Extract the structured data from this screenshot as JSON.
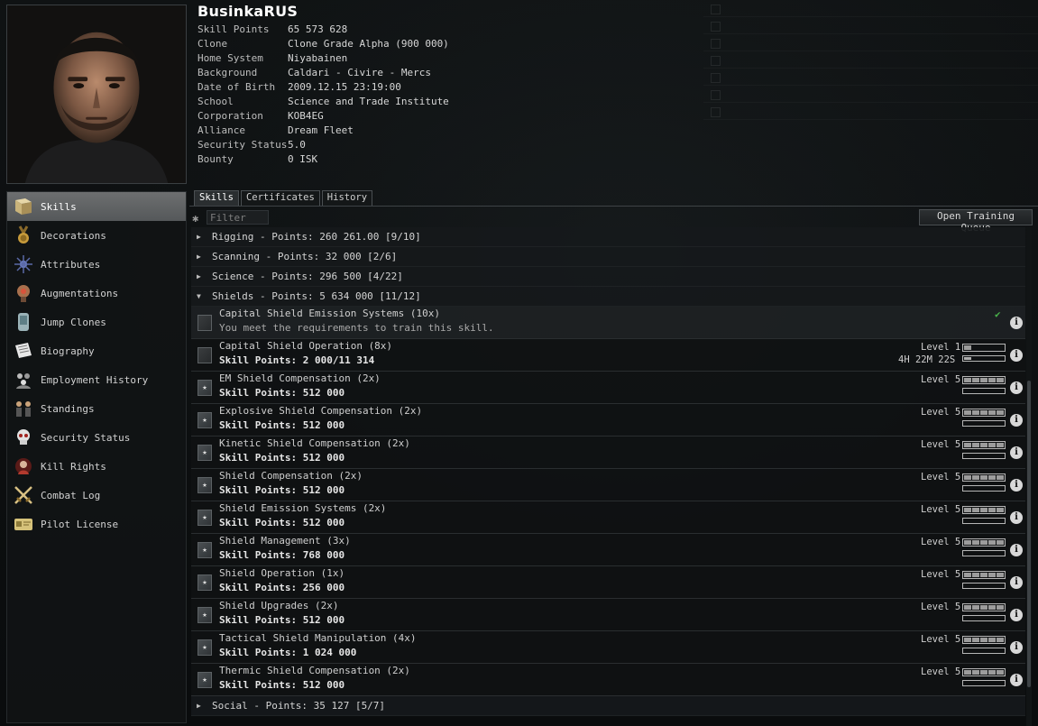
{
  "character": {
    "name": "BusinkaRUS",
    "info": [
      {
        "label": "Skill Points",
        "value": "65 573 628"
      },
      {
        "label": "Clone",
        "value": "Clone Grade Alpha (900 000)"
      },
      {
        "label": "Home System",
        "value": "Niyabainen"
      },
      {
        "label": "Background",
        "value": "Caldari - Civire - Mercs"
      },
      {
        "label": "Date of Birth",
        "value": "2009.12.15 23:19:00"
      },
      {
        "label": "School",
        "value": "Science and Trade Institute"
      },
      {
        "label": "Corporation",
        "value": "KOB4EG"
      },
      {
        "label": "Alliance",
        "value": "Dream Fleet"
      },
      {
        "label": "Security Status",
        "value": "5.0"
      },
      {
        "label": "Bounty",
        "value": "0 ISK"
      }
    ]
  },
  "nav": {
    "items": [
      {
        "label": "Skills",
        "icon": "skills-book-icon",
        "active": true
      },
      {
        "label": "Decorations",
        "icon": "medal-icon",
        "active": false
      },
      {
        "label": "Attributes",
        "icon": "attributes-icon",
        "active": false
      },
      {
        "label": "Augmentations",
        "icon": "implant-icon",
        "active": false
      },
      {
        "label": "Jump Clones",
        "icon": "jump-clone-icon",
        "active": false
      },
      {
        "label": "Biography",
        "icon": "biography-icon",
        "active": false
      },
      {
        "label": "Employment History",
        "icon": "employment-icon",
        "active": false
      },
      {
        "label": "Standings",
        "icon": "standings-icon",
        "active": false
      },
      {
        "label": "Security Status",
        "icon": "skull-icon",
        "active": false
      },
      {
        "label": "Kill Rights",
        "icon": "kill-rights-icon",
        "active": false
      },
      {
        "label": "Combat Log",
        "icon": "crossed-swords-icon",
        "active": false
      },
      {
        "label": "Pilot License",
        "icon": "license-card-icon",
        "active": false
      }
    ]
  },
  "tabs": {
    "skills": "Skills",
    "certificates": "Certificates",
    "history": "History"
  },
  "toolbar": {
    "filter_placeholder": "Filter",
    "open_queue_label": "Open Training Queue"
  },
  "groups_top": [
    {
      "label": "Rigging - Points: 260 261.00 [9/10]",
      "expanded": false
    },
    {
      "label": "Scanning - Points: 32 000 [2/6]",
      "expanded": false
    },
    {
      "label": "Science - Points: 296 500 [4/22]",
      "expanded": false
    },
    {
      "label": "Shields - Points: 5 634 000 [11/12]",
      "expanded": true
    }
  ],
  "shield_skills": [
    {
      "name": "Capital Shield Emission Systems (10x)",
      "note": "You meet the requirements to train this skill.",
      "untrained": true,
      "can_train": true
    },
    {
      "name": "Capital Shield Operation (8x)",
      "points": "Skill Points: 2 000/11 314",
      "level": "Level 1",
      "level_num": 1,
      "timer": "4H 22M 22S",
      "progress": 0.18,
      "untrained": true
    },
    {
      "name": "EM Shield Compensation (2x)",
      "points": "Skill Points: 512 000",
      "level": "Level 5",
      "level_num": 5
    },
    {
      "name": "Explosive Shield Compensation (2x)",
      "points": "Skill Points: 512 000",
      "level": "Level 5",
      "level_num": 5
    },
    {
      "name": "Kinetic Shield Compensation (2x)",
      "points": "Skill Points: 512 000",
      "level": "Level 5",
      "level_num": 5
    },
    {
      "name": "Shield Compensation (2x)",
      "points": "Skill Points: 512 000",
      "level": "Level 5",
      "level_num": 5
    },
    {
      "name": "Shield Emission Systems (2x)",
      "points": "Skill Points: 512 000",
      "level": "Level 5",
      "level_num": 5
    },
    {
      "name": "Shield Management (3x)",
      "points": "Skill Points: 768 000",
      "level": "Level 5",
      "level_num": 5
    },
    {
      "name": "Shield Operation (1x)",
      "points": "Skill Points: 256 000",
      "level": "Level 5",
      "level_num": 5
    },
    {
      "name": "Shield Upgrades (2x)",
      "points": "Skill Points: 512 000",
      "level": "Level 5",
      "level_num": 5
    },
    {
      "name": "Tactical Shield Manipulation (4x)",
      "points": "Skill Points: 1 024 000",
      "level": "Level 5",
      "level_num": 5
    },
    {
      "name": "Thermic Shield Compensation (2x)",
      "points": "Skill Points: 512 000",
      "level": "Level 5",
      "level_num": 5
    }
  ],
  "groups_bottom": [
    {
      "label": "Social - Points: 35 127 [5/7]",
      "expanded": false
    }
  ]
}
